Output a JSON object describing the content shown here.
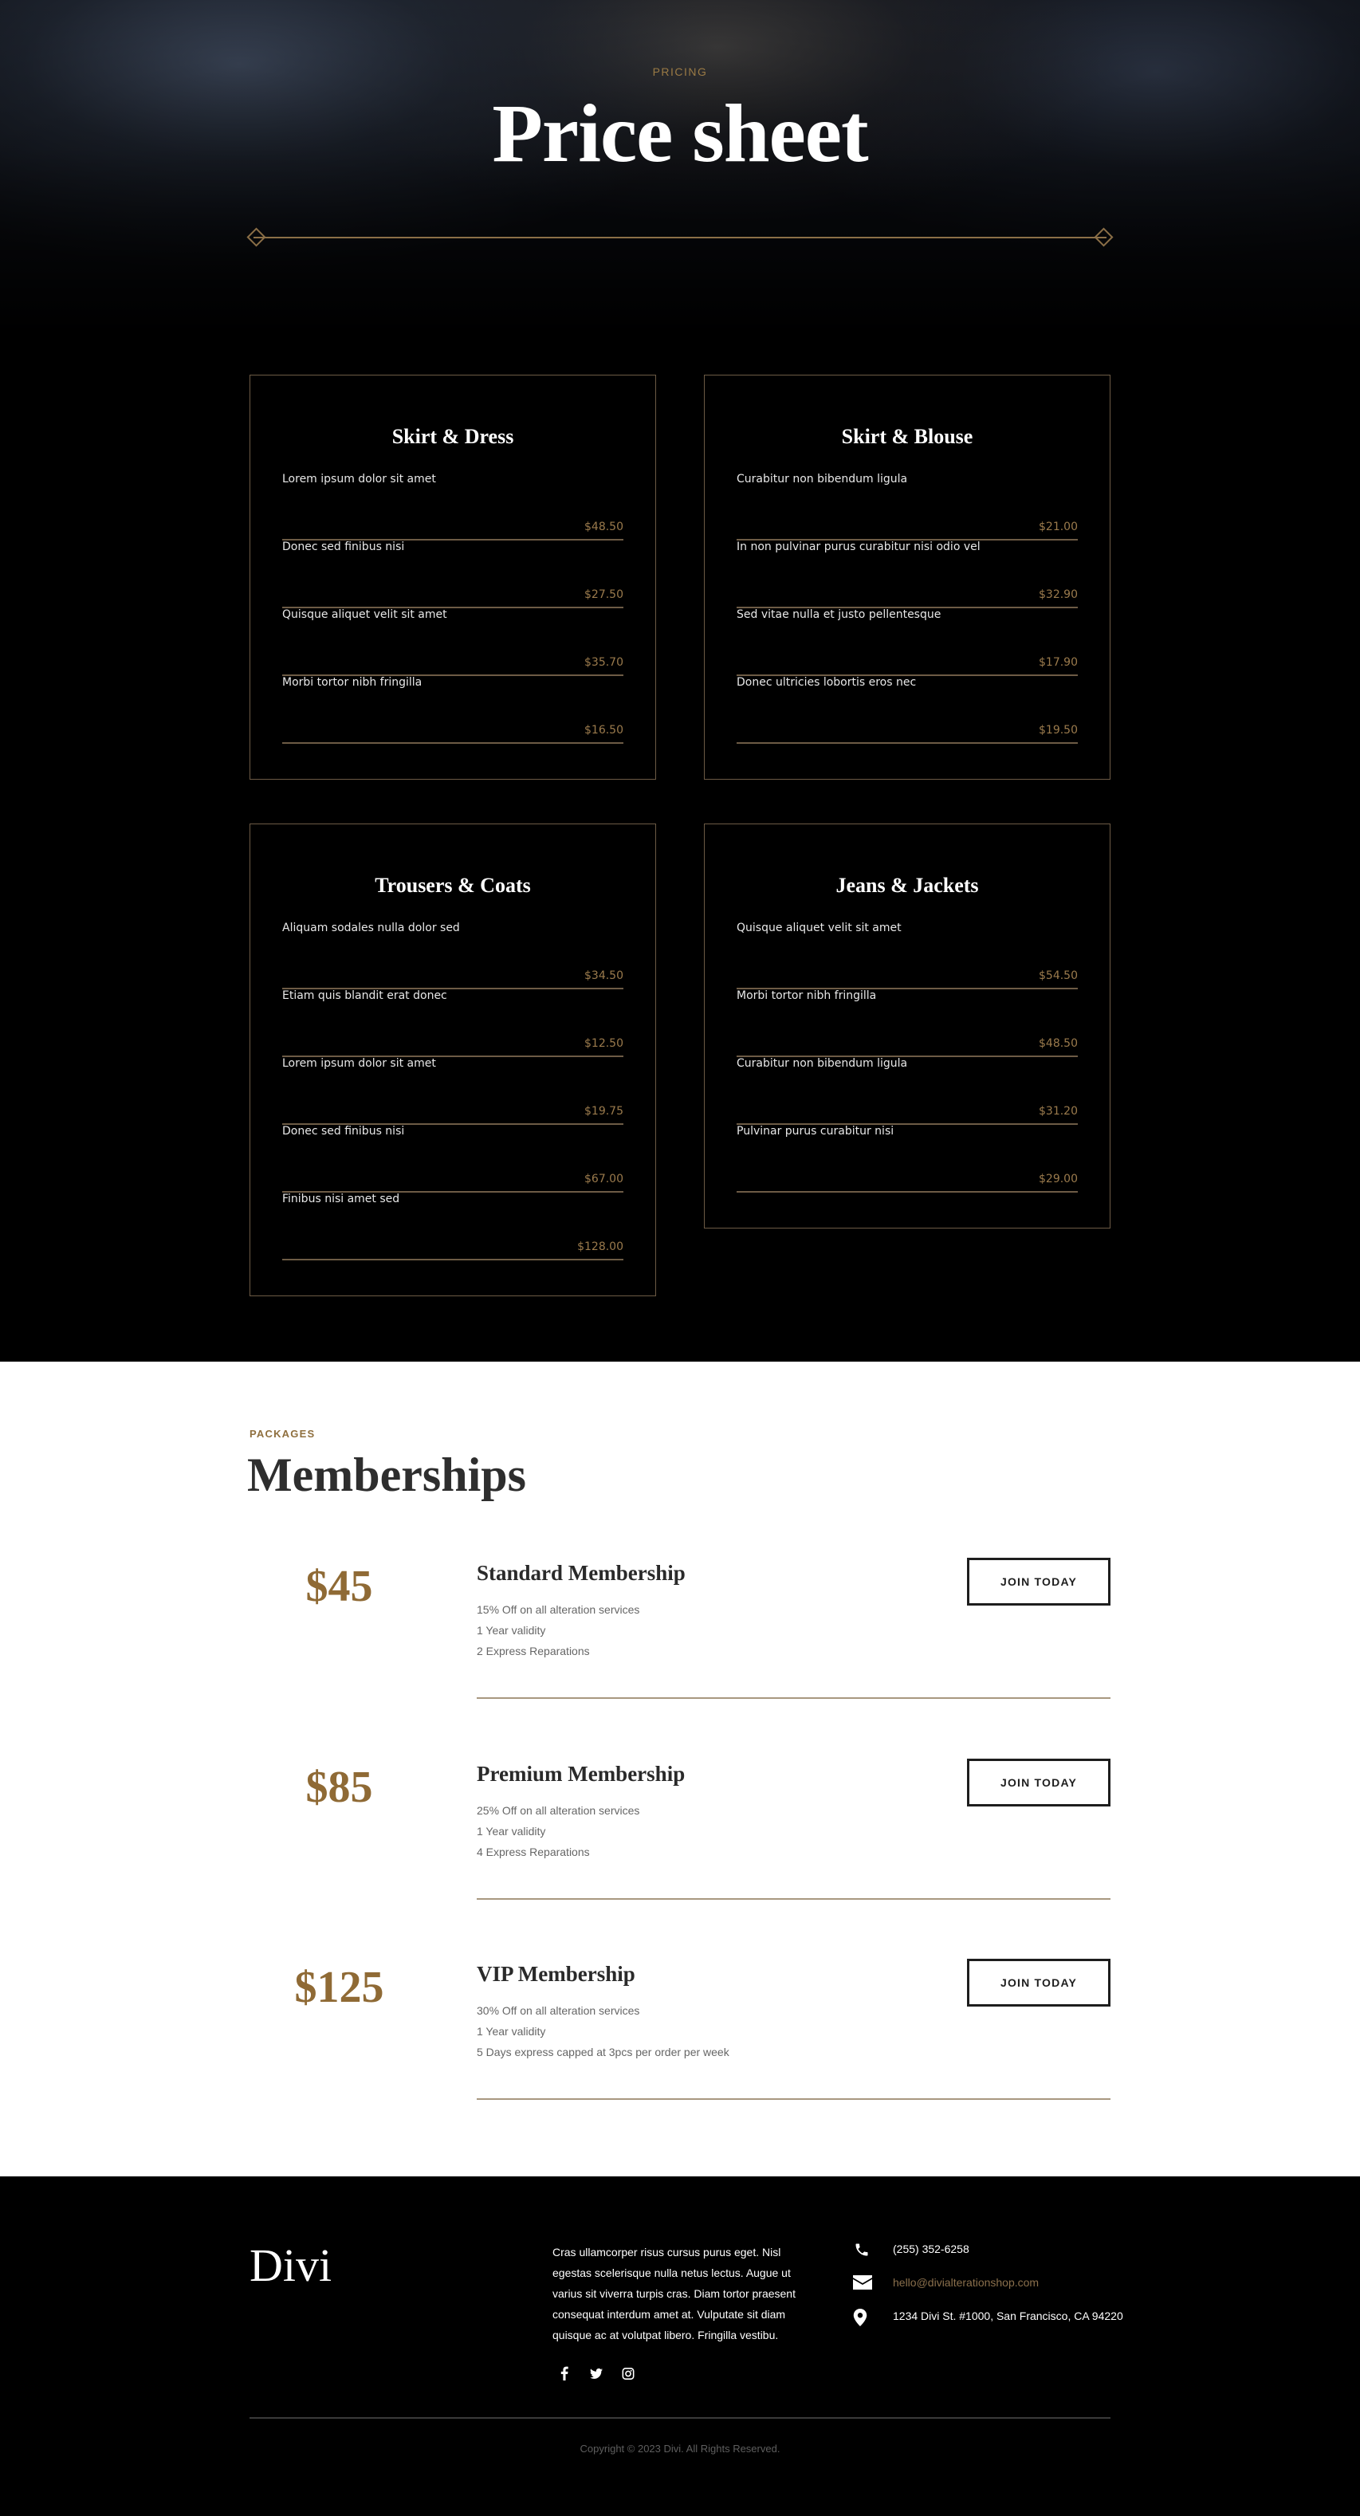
{
  "hero": {
    "eyebrow": "PRICING",
    "title": "Price sheet"
  },
  "price_cards": [
    {
      "title": "Skirt & Dress",
      "items": [
        {
          "name": "Lorem ipsum dolor sit amet",
          "price": "$48.50"
        },
        {
          "name": "Donec sed finibus nisi",
          "price": "$27.50"
        },
        {
          "name": "Quisque aliquet velit sit amet",
          "price": "$35.70"
        },
        {
          "name": "Morbi tortor nibh fringilla",
          "price": "$16.50"
        }
      ]
    },
    {
      "title": "Skirt & Blouse",
      "items": [
        {
          "name": "Curabitur non bibendum ligula",
          "price": "$21.00"
        },
        {
          "name": "In non pulvinar purus curabitur nisi odio vel",
          "price": "$32.90"
        },
        {
          "name": "Sed vitae nulla et justo pellentesque",
          "price": "$17.90"
        },
        {
          "name": "Donec ultricies lobortis eros nec",
          "price": "$19.50"
        }
      ]
    },
    {
      "title": "Trousers & Coats",
      "items": [
        {
          "name": "Aliquam sodales nulla dolor sed",
          "price": "$34.50"
        },
        {
          "name": "Etiam quis blandit erat donec",
          "price": "$12.50"
        },
        {
          "name": "Lorem ipsum dolor sit amet",
          "price": "$19.75"
        },
        {
          "name": "Donec sed finibus nisi",
          "price": "$67.00"
        },
        {
          "name": "Finibus nisi amet sed",
          "price": "$128.00"
        }
      ]
    },
    {
      "title": "Jeans & Jackets",
      "items": [
        {
          "name": "Quisque aliquet velit sit amet",
          "price": "$54.50"
        },
        {
          "name": "Morbi tortor nibh fringilla",
          "price": "$48.50"
        },
        {
          "name": "Curabitur non bibendum ligula",
          "price": "$31.20"
        },
        {
          "name": "Pulvinar purus curabitur nisi",
          "price": "$29.00"
        }
      ]
    }
  ],
  "memberships": {
    "eyebrow": "PACKAGES",
    "title": "Memberships",
    "plans": [
      {
        "price": "$45",
        "name": "Standard Membership",
        "features": [
          "15% Off on all alteration services",
          "1 Year validity",
          "2 Express Reparations"
        ],
        "button": "JOIN TODAY"
      },
      {
        "price": "$85",
        "name": "Premium Membership",
        "features": [
          "25% Off on all alteration services",
          "1 Year validity",
          "4 Express Reparations"
        ],
        "button": "JOIN TODAY"
      },
      {
        "price": "$125",
        "name": "VIP Membership",
        "features": [
          "30% Off on all alteration services",
          "1 Year validity",
          "5 Days express capped at 3pcs per order per week"
        ],
        "button": "JOIN TODAY"
      }
    ]
  },
  "footer": {
    "logo": "Divi",
    "about": "Cras ullamcorper risus cursus purus eget. Nisl egestas scelerisque nulla netus lectus. Augue ut varius sit viverra turpis cras. Diam tortor praesent consequat interdum amet at. Vulputate sit diam quisque ac at volutpat libero. Fringilla vestibu.",
    "social": [
      {
        "icon": "facebook-icon",
        "glyph": "f"
      },
      {
        "icon": "twitter-icon",
        "glyph": "t"
      },
      {
        "icon": "instagram-icon",
        "glyph": "i"
      }
    ],
    "phone": "(255) 352-6258",
    "email": "hello@divialterationshop.com",
    "address": "1234 Divi St. #1000, San Francisco, CA 94220",
    "copyright": "Copyright © 2023 Divi. All Rights Reserved."
  },
  "colors": {
    "accent_gold": "#8f6a35",
    "card_border": "#6d5b45",
    "price_text": "#9a7a4c"
  }
}
